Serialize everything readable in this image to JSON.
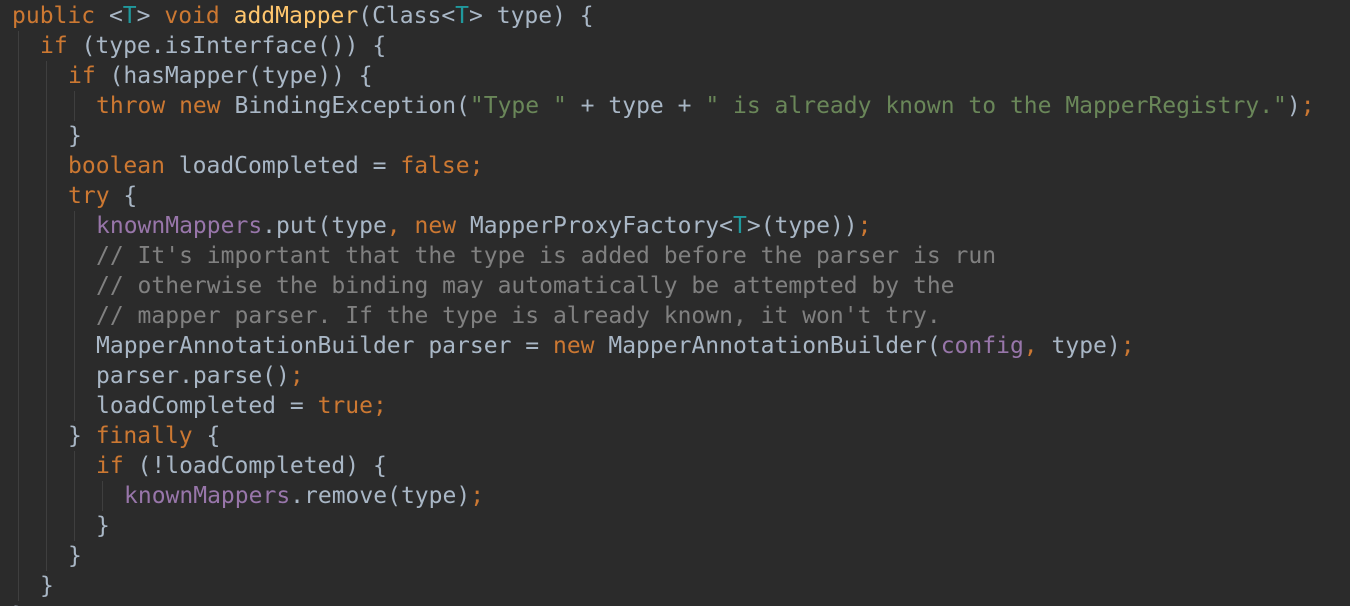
{
  "editor": {
    "theme_colors": {
      "background": "#2b2b2b",
      "keyword": "#cc7832",
      "plain": "#a9b7c6",
      "function": "#ffc66d",
      "string": "#6a8759",
      "field": "#9876aa",
      "comment": "#808080",
      "type_param": "#20999d"
    },
    "lines": [
      {
        "indent": 0,
        "tokens": [
          [
            "kw",
            "public "
          ],
          [
            "plain",
            "<"
          ],
          [
            "tparam",
            "T"
          ],
          [
            "plain",
            "> "
          ],
          [
            "kw",
            "void "
          ],
          [
            "fn",
            "addMapper"
          ],
          [
            "plain",
            "(Class<"
          ],
          [
            "tparam",
            "T"
          ],
          [
            "plain",
            "> type) {"
          ]
        ]
      },
      {
        "indent": 1,
        "tokens": [
          [
            "kw",
            "if "
          ],
          [
            "plain",
            "(type.isInterface()) {"
          ]
        ]
      },
      {
        "indent": 2,
        "tokens": [
          [
            "kw",
            "if "
          ],
          [
            "plain",
            "(hasMapper(type)) {"
          ]
        ]
      },
      {
        "indent": 3,
        "tokens": [
          [
            "kw",
            "throw new "
          ],
          [
            "plain",
            "BindingException("
          ],
          [
            "str",
            "\"Type \""
          ],
          [
            "plain",
            " + type + "
          ],
          [
            "str",
            "\" is already known to the MapperRegistry.\""
          ],
          [
            "plain",
            ")"
          ],
          [
            "punct",
            ";"
          ]
        ]
      },
      {
        "indent": 2,
        "tokens": [
          [
            "plain",
            "}"
          ]
        ]
      },
      {
        "indent": 2,
        "tokens": [
          [
            "kw",
            "boolean "
          ],
          [
            "plain",
            "loadCompleted = "
          ],
          [
            "kw",
            "false"
          ],
          [
            "punct",
            ";"
          ]
        ]
      },
      {
        "indent": 2,
        "tokens": [
          [
            "kw",
            "try "
          ],
          [
            "plain",
            "{"
          ]
        ]
      },
      {
        "indent": 3,
        "tokens": [
          [
            "field",
            "knownMappers"
          ],
          [
            "plain",
            ".put(type"
          ],
          [
            "punct",
            ", "
          ],
          [
            "kw",
            "new "
          ],
          [
            "plain",
            "MapperProxyFactory<"
          ],
          [
            "tparam",
            "T"
          ],
          [
            "plain",
            ">(type))"
          ],
          [
            "punct",
            ";"
          ]
        ]
      },
      {
        "indent": 3,
        "tokens": [
          [
            "comment",
            "// It's important that the type is added before the parser is run"
          ]
        ]
      },
      {
        "indent": 3,
        "tokens": [
          [
            "comment",
            "// otherwise the binding may automatically be attempted by the"
          ]
        ]
      },
      {
        "indent": 3,
        "tokens": [
          [
            "comment",
            "// mapper parser. If the type is already known, it won't try."
          ]
        ]
      },
      {
        "indent": 3,
        "tokens": [
          [
            "plain",
            "MapperAnnotationBuilder parser = "
          ],
          [
            "kw",
            "new "
          ],
          [
            "plain",
            "MapperAnnotationBuilder("
          ],
          [
            "field",
            "config"
          ],
          [
            "punct",
            ", "
          ],
          [
            "plain",
            "type)"
          ],
          [
            "punct",
            ";"
          ]
        ]
      },
      {
        "indent": 3,
        "tokens": [
          [
            "plain",
            "parser.parse()"
          ],
          [
            "punct",
            ";"
          ]
        ]
      },
      {
        "indent": 3,
        "tokens": [
          [
            "plain",
            "loadCompleted = "
          ],
          [
            "kw",
            "true"
          ],
          [
            "punct",
            ";"
          ]
        ]
      },
      {
        "indent": 2,
        "tokens": [
          [
            "plain",
            "} "
          ],
          [
            "kw",
            "finally "
          ],
          [
            "plain",
            "{"
          ]
        ]
      },
      {
        "indent": 3,
        "tokens": [
          [
            "kw",
            "if "
          ],
          [
            "plain",
            "(!loadCompleted) {"
          ]
        ]
      },
      {
        "indent": 4,
        "tokens": [
          [
            "field",
            "knownMappers"
          ],
          [
            "plain",
            ".remove(type)"
          ],
          [
            "punct",
            ";"
          ]
        ]
      },
      {
        "indent": 3,
        "tokens": [
          [
            "plain",
            "}"
          ]
        ]
      },
      {
        "indent": 2,
        "tokens": [
          [
            "plain",
            "}"
          ]
        ]
      },
      {
        "indent": 1,
        "tokens": [
          [
            "plain",
            "}"
          ]
        ]
      },
      {
        "indent": 0,
        "tokens": [
          [
            "plain",
            "}"
          ]
        ]
      }
    ]
  }
}
